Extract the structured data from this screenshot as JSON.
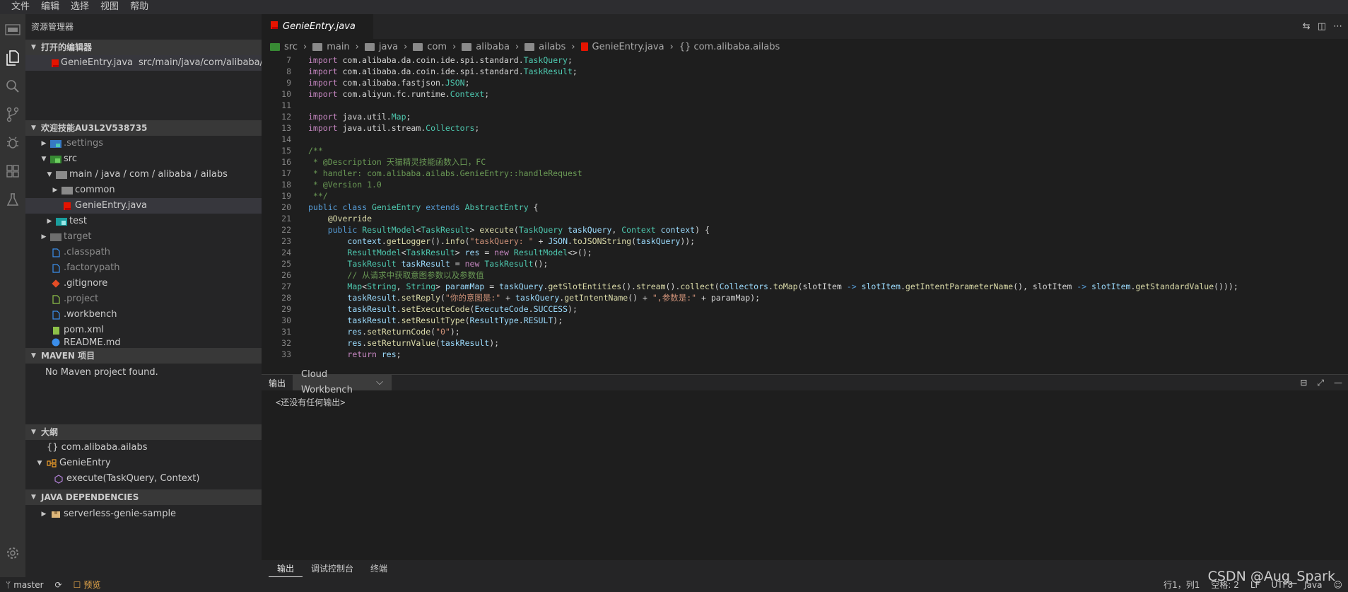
{
  "menubar": {
    "items": [
      "文件",
      "编辑",
      "选择",
      "视图",
      "帮助"
    ]
  },
  "sidebar": {
    "title": "资源管理器",
    "open_editors": {
      "label": "打开的编辑器",
      "items": [
        {
          "name": "GenieEntry.java",
          "path": "src/main/java/com/alibaba/..."
        }
      ]
    },
    "workspace": {
      "label": "欢迎技能AU3L2V538735",
      "tree": [
        {
          "name": ".settings"
        },
        {
          "name": "src"
        },
        {
          "name": "main / java / com / alibaba / ailabs"
        },
        {
          "name": "common"
        },
        {
          "name": "GenieEntry.java"
        },
        {
          "name": "test"
        },
        {
          "name": "target"
        },
        {
          "name": ".classpath"
        },
        {
          "name": ".factorypath"
        },
        {
          "name": ".gitignore"
        },
        {
          "name": ".project"
        },
        {
          "name": ".workbench"
        },
        {
          "name": "pom.xml"
        },
        {
          "name": "README.md"
        }
      ]
    },
    "maven": {
      "label": "MAVEN 项目",
      "empty": "No Maven project found."
    },
    "outline": {
      "label": "大纲",
      "items": [
        "{} com.alibaba.ailabs",
        "GenieEntry",
        "execute(TaskQuery, Context)"
      ]
    },
    "java_deps": {
      "label": "JAVA DEPENDENCIES",
      "items": [
        "serverless-genie-sample"
      ]
    }
  },
  "editor": {
    "tab": "GenieEntry.java",
    "breadcrumb": [
      "src",
      "main",
      "java",
      "com",
      "alibaba",
      "ailabs",
      "GenieEntry.java",
      "{} com.alibaba.ailabs"
    ],
    "line_numbers": [
      "7",
      "8",
      "9",
      "10",
      "11",
      "12",
      "13",
      "14",
      "15",
      "16",
      "17",
      "18",
      "19",
      "20",
      "21",
      "22",
      "23",
      "24",
      "25",
      "26",
      "27",
      "28",
      "29",
      "30",
      "31",
      "32",
      "33"
    ]
  },
  "panel": {
    "title": "输出",
    "channel": "Cloud Workbench",
    "body": "<还没有任何输出>",
    "tabs": [
      "输出",
      "调试控制台",
      "终端"
    ]
  },
  "statusbar": {
    "branch": "master",
    "preview": "预览",
    "position": "行1，列1",
    "spaces": "空格: 2",
    "eol": "LF",
    "encoding": "UTF8",
    "language": "Java"
  },
  "watermark": "CSDN @Aug_Spark",
  "colors": {
    "accent": "#007acc",
    "java_icon": "#e51400",
    "folder": "#8a8a8a"
  }
}
